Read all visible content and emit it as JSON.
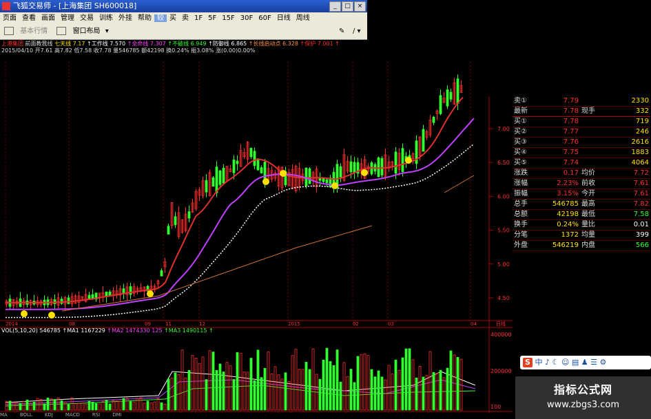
{
  "window": {
    "app_title": "飞狐交易师",
    "doc_title": "[上海集团 SH600018]",
    "buttons": [
      "_",
      "□",
      "×"
    ]
  },
  "menu": [
    "页面",
    "查看",
    "画面",
    "管理",
    "交易",
    "训练",
    "外挂",
    "帮助",
    "较",
    "买",
    "卖",
    "1F",
    "5F",
    "15F",
    "30F",
    "60F",
    "日线",
    "周线"
  ],
  "menu_active_index": 8,
  "toolbar": {
    "item1": "基本行情",
    "item2": "窗口布局"
  },
  "info_line1": [
    {
      "t": "上港集团",
      "c": "#ff3030"
    },
    {
      "t": " 前面教我线",
      "c": "#ddd"
    },
    {
      "t": " 七天线 7.17",
      "c": "#ffe000"
    },
    {
      "t": " ↑工作线 7.570",
      "c": "#fff"
    },
    {
      "t": " ↑全命线 7.307",
      "c": "#ff40ff"
    },
    {
      "t": " ↑不破线 6.949",
      "c": "#30ff30"
    },
    {
      "t": " ↑防御线 6.865",
      "c": "#fff"
    },
    {
      "t": " ↑长线启动点 6.328",
      "c": "#ff9040"
    },
    {
      "t": " ↑保护 7.001 ↑",
      "c": "#ff3030"
    }
  ],
  "info_line2": "2015/04/10 开7.61 高7.82 低7.58 收7.78 量546785 额42198 换0.24% 振3.08% 涨(0.00)0.00%",
  "quote": {
    "orders": [
      {
        "label": "卖①",
        "price": "7.79",
        "vol": "2330"
      },
      {
        "label": "最新",
        "price": "7.78",
        "extra_label": "现手",
        "extra": "332"
      },
      {
        "label": "买①",
        "price": "7.78",
        "vol": "719"
      },
      {
        "label": "买②",
        "price": "7.77",
        "vol": "246"
      },
      {
        "label": "买③",
        "price": "7.76",
        "vol": "2616"
      },
      {
        "label": "买④",
        "price": "7.75",
        "vol": "1883"
      },
      {
        "label": "买⑤",
        "price": "7.74",
        "vol": "4064"
      }
    ],
    "stats": [
      {
        "l": "涨跌",
        "v": "0.17",
        "l2": "均价",
        "v2": "7.72"
      },
      {
        "l": "涨幅",
        "v": "2.23%",
        "l2": "前收",
        "v2": "7.61"
      },
      {
        "l": "振幅",
        "v": "3.15%",
        "l2": "今开",
        "v2": "7.61"
      },
      {
        "l": "总手",
        "v": "546785",
        "l2": "最高",
        "v2": "7.82"
      },
      {
        "l": "总额",
        "v": "42198",
        "l2": "最低",
        "v2": "7.58"
      },
      {
        "l": "换手",
        "v": "0.24%",
        "l2": "量比",
        "v2": "0.01"
      },
      {
        "l": "分笔",
        "v": "1372",
        "l2": "均量",
        "v2": "399"
      },
      {
        "l": "外盘",
        "v": "546219",
        "l2": "内盘",
        "v2": "566"
      }
    ]
  },
  "price_axis": [
    "7.00",
    "6.50",
    "6.00",
    "5.50",
    "5.00",
    "4.50"
  ],
  "date_axis": [
    "2014",
    "08",
    "09",
    "11",
    "12",
    "2015",
    "02",
    "03",
    "04",
    "日线"
  ],
  "vol_axis": [
    "400000",
    "200000",
    "100"
  ],
  "vol_info": [
    {
      "t": "VOL(5,10,20) 546785",
      "c": "#fff"
    },
    {
      "t": " ↑MA1 1167229",
      "c": "#fff"
    },
    {
      "t": " ↑MA2 1474330 125",
      "c": "#ff40ff"
    },
    {
      "t": " ↑MA3 1490115 ↑",
      "c": "#30ff30"
    }
  ],
  "bottom_tabs": [
    "MA",
    "BOLL",
    "KDJ",
    "MACD",
    "RSI",
    "DMI"
  ],
  "ime": {
    "badge": "S",
    "text": "中 ♪ ☾ ☺ ▤ ♟ ☰ ⚙"
  },
  "watermark": {
    "line1": "指标公式网",
    "line2": "www.zbgs3.com"
  },
  "colors": {
    "up": "#ff3030",
    "down": "#30ff30",
    "ma_main": "#e03030",
    "ma_pink": "#c040ff",
    "ma_white": "#ffffff",
    "ma_orange": "#d07030",
    "bg": "#000000"
  }
}
